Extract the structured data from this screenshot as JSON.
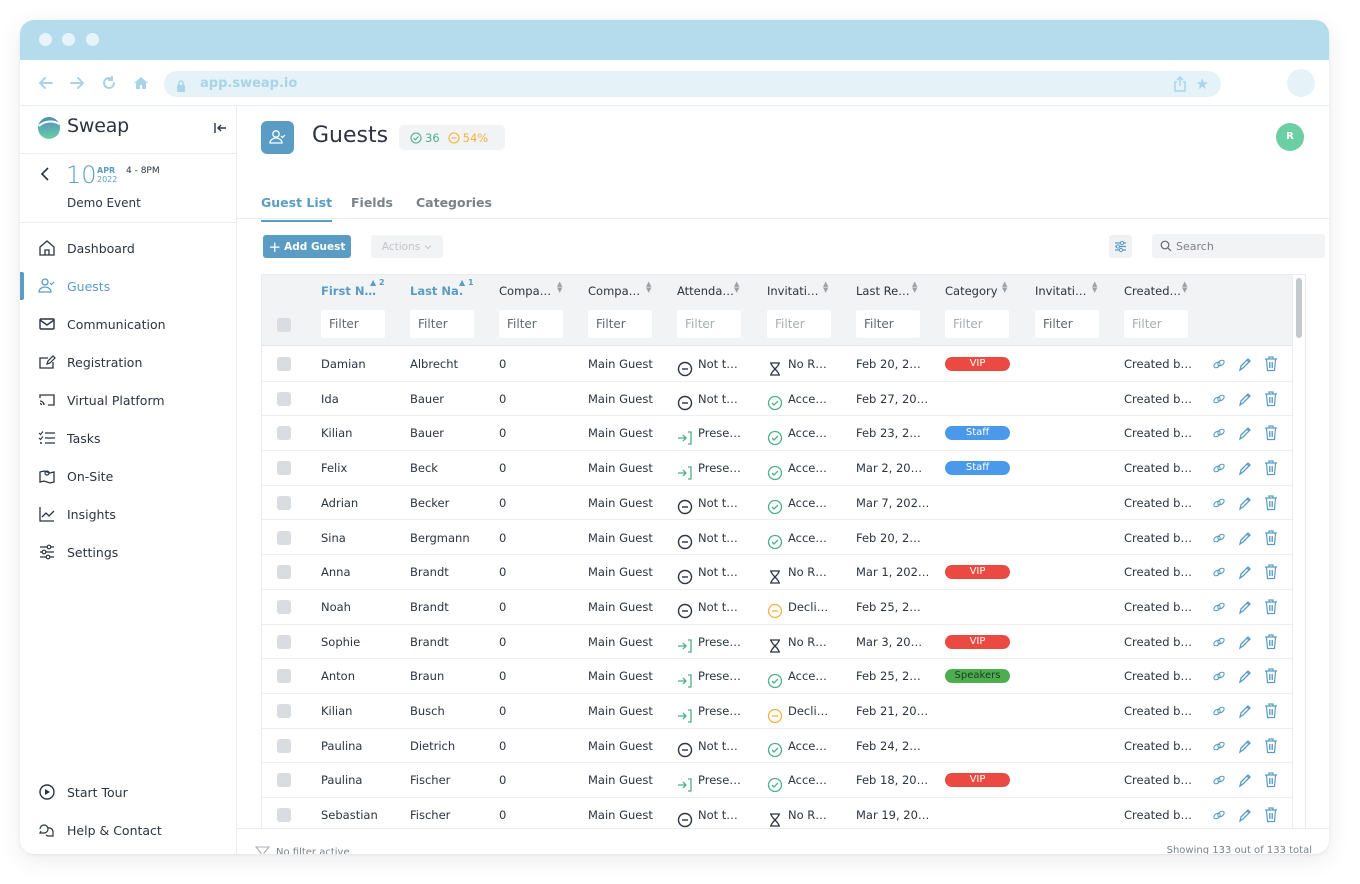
{
  "browser": {
    "url": "app.sweap.io"
  },
  "brand": {
    "name": "Sweap",
    "accent": "#5a9cc3"
  },
  "event": {
    "day": "10",
    "month": "APR",
    "year": "2022",
    "time": "4 - 8PM",
    "name": "Demo Event"
  },
  "sidebar": {
    "items": [
      {
        "label": "Dashboard",
        "icon": "home-icon"
      },
      {
        "label": "Guests",
        "icon": "guest-icon",
        "active": true
      },
      {
        "label": "Communication",
        "icon": "mail-icon"
      },
      {
        "label": "Registration",
        "icon": "registration-icon"
      },
      {
        "label": "Virtual Platform",
        "icon": "cast-icon"
      },
      {
        "label": "Tasks",
        "icon": "tasks-icon"
      },
      {
        "label": "On-Site",
        "icon": "map-icon"
      },
      {
        "label": "Insights",
        "icon": "chart-icon"
      },
      {
        "label": "Settings",
        "icon": "sliders-icon"
      }
    ],
    "bottom": [
      {
        "label": "Start Tour",
        "icon": "play-icon"
      },
      {
        "label": "Help & Contact",
        "icon": "chat-icon"
      }
    ]
  },
  "header": {
    "title": "Guests",
    "stat_accepted": "36",
    "stat_declined": "54%",
    "avatar_initial": "R"
  },
  "tabs": [
    {
      "label": "Guest List",
      "active": true
    },
    {
      "label": "Fields"
    },
    {
      "label": "Categories"
    }
  ],
  "toolbar": {
    "add_label": "Add Guest",
    "actions_label": "Actions",
    "search_placeholder": "Search"
  },
  "table": {
    "columns": [
      {
        "label": "First N…",
        "sort": "asc",
        "sort_order": "2"
      },
      {
        "label": "Last Na.",
        "sort": "asc",
        "sort_order": "1"
      },
      {
        "label": "Compa…"
      },
      {
        "label": "Compa…"
      },
      {
        "label": "Attenda…"
      },
      {
        "label": "Invitati…"
      },
      {
        "label": "Last Re…"
      },
      {
        "label": "Category"
      },
      {
        "label": "Invitati…"
      },
      {
        "label": "Created…"
      }
    ],
    "filter_placeholder": "Filter",
    "rows": [
      {
        "first": "Damian",
        "last": "Albrecht",
        "companions": "0",
        "type": "Main Guest",
        "attendance": "Not t…",
        "attendance_state": "not",
        "invitation": "No R…",
        "invitation_state": "pending",
        "last_reply": "Feb 20, 2…",
        "category": "VIP",
        "created": "Created b…"
      },
      {
        "first": "Ida",
        "last": "Bauer",
        "companions": "0",
        "type": "Main Guest",
        "attendance": "Not t…",
        "attendance_state": "not",
        "invitation": "Acce…",
        "invitation_state": "accepted",
        "last_reply": "Feb 27, 20…",
        "category": "",
        "created": "Created b…"
      },
      {
        "first": "Kilian",
        "last": "Bauer",
        "companions": "0",
        "type": "Main Guest",
        "attendance": "Prese…",
        "attendance_state": "present",
        "invitation": "Acce…",
        "invitation_state": "accepted",
        "last_reply": "Feb 23, 2…",
        "category": "Staff",
        "created": "Created b…"
      },
      {
        "first": "Felix",
        "last": "Beck",
        "companions": "0",
        "type": "Main Guest",
        "attendance": "Prese…",
        "attendance_state": "present",
        "invitation": "Acce…",
        "invitation_state": "accepted",
        "last_reply": "Mar 2, 20…",
        "category": "Staff",
        "created": "Created b…"
      },
      {
        "first": "Adrian",
        "last": "Becker",
        "companions": "0",
        "type": "Main Guest",
        "attendance": "Not t…",
        "attendance_state": "not",
        "invitation": "Acce…",
        "invitation_state": "accepted",
        "last_reply": "Mar 7, 202…",
        "category": "",
        "created": "Created b…"
      },
      {
        "first": "Sina",
        "last": "Bergmann",
        "companions": "0",
        "type": "Main Guest",
        "attendance": "Not t…",
        "attendance_state": "not",
        "invitation": "Acce…",
        "invitation_state": "accepted",
        "last_reply": "Feb 20, 2…",
        "category": "",
        "created": "Created b…"
      },
      {
        "first": "Anna",
        "last": "Brandt",
        "companions": "0",
        "type": "Main Guest",
        "attendance": "Not t…",
        "attendance_state": "not",
        "invitation": "No R…",
        "invitation_state": "pending",
        "last_reply": "Mar 1, 202…",
        "category": "VIP",
        "created": "Created b…"
      },
      {
        "first": "Noah",
        "last": "Brandt",
        "companions": "0",
        "type": "Main Guest",
        "attendance": "Not t…",
        "attendance_state": "not",
        "invitation": "Decli…",
        "invitation_state": "declined",
        "last_reply": "Feb 25, 2…",
        "category": "",
        "created": "Created b…"
      },
      {
        "first": "Sophie",
        "last": "Brandt",
        "companions": "0",
        "type": "Main Guest",
        "attendance": "Prese…",
        "attendance_state": "present",
        "invitation": "No R…",
        "invitation_state": "pending",
        "last_reply": "Mar 3, 20…",
        "category": "VIP",
        "created": "Created b…"
      },
      {
        "first": "Anton",
        "last": "Braun",
        "companions": "0",
        "type": "Main Guest",
        "attendance": "Prese…",
        "attendance_state": "present",
        "invitation": "Acce…",
        "invitation_state": "accepted",
        "last_reply": "Feb 25, 2…",
        "category": "Speakers",
        "created": "Created b…"
      },
      {
        "first": "Kilian",
        "last": "Busch",
        "companions": "0",
        "type": "Main Guest",
        "attendance": "Prese…",
        "attendance_state": "present",
        "invitation": "Decli…",
        "invitation_state": "declined",
        "last_reply": "Feb 21, 20…",
        "category": "",
        "created": "Created b…"
      },
      {
        "first": "Paulina",
        "last": "Dietrich",
        "companions": "0",
        "type": "Main Guest",
        "attendance": "Not t…",
        "attendance_state": "not",
        "invitation": "Acce…",
        "invitation_state": "accepted",
        "last_reply": "Feb 24, 2…",
        "category": "",
        "created": "Created b…"
      },
      {
        "first": "Paulina",
        "last": "Fischer",
        "companions": "0",
        "type": "Main Guest",
        "attendance": "Prese…",
        "attendance_state": "present",
        "invitation": "Acce…",
        "invitation_state": "accepted",
        "last_reply": "Feb 18, 20…",
        "category": "VIP",
        "created": "Created b…"
      },
      {
        "first": "Sebastian",
        "last": "Fischer",
        "companions": "0",
        "type": "Main Guest",
        "attendance": "Not t…",
        "attendance_state": "not",
        "invitation": "No R…",
        "invitation_state": "pending",
        "last_reply": "Mar 19, 20…",
        "category": "",
        "created": "Created b…"
      }
    ]
  },
  "category_colors": {
    "VIP": "#ea4a41",
    "Staff": "#4a99ea",
    "Speakers": "#4cae4f"
  },
  "category_text_colors": {
    "VIP": "#ffffff",
    "Staff": "#ffffff",
    "Speakers": "#1d3a1e"
  },
  "footer": {
    "filter_status": "No filter active",
    "count_text": "Showing 133 out of 133 total"
  }
}
